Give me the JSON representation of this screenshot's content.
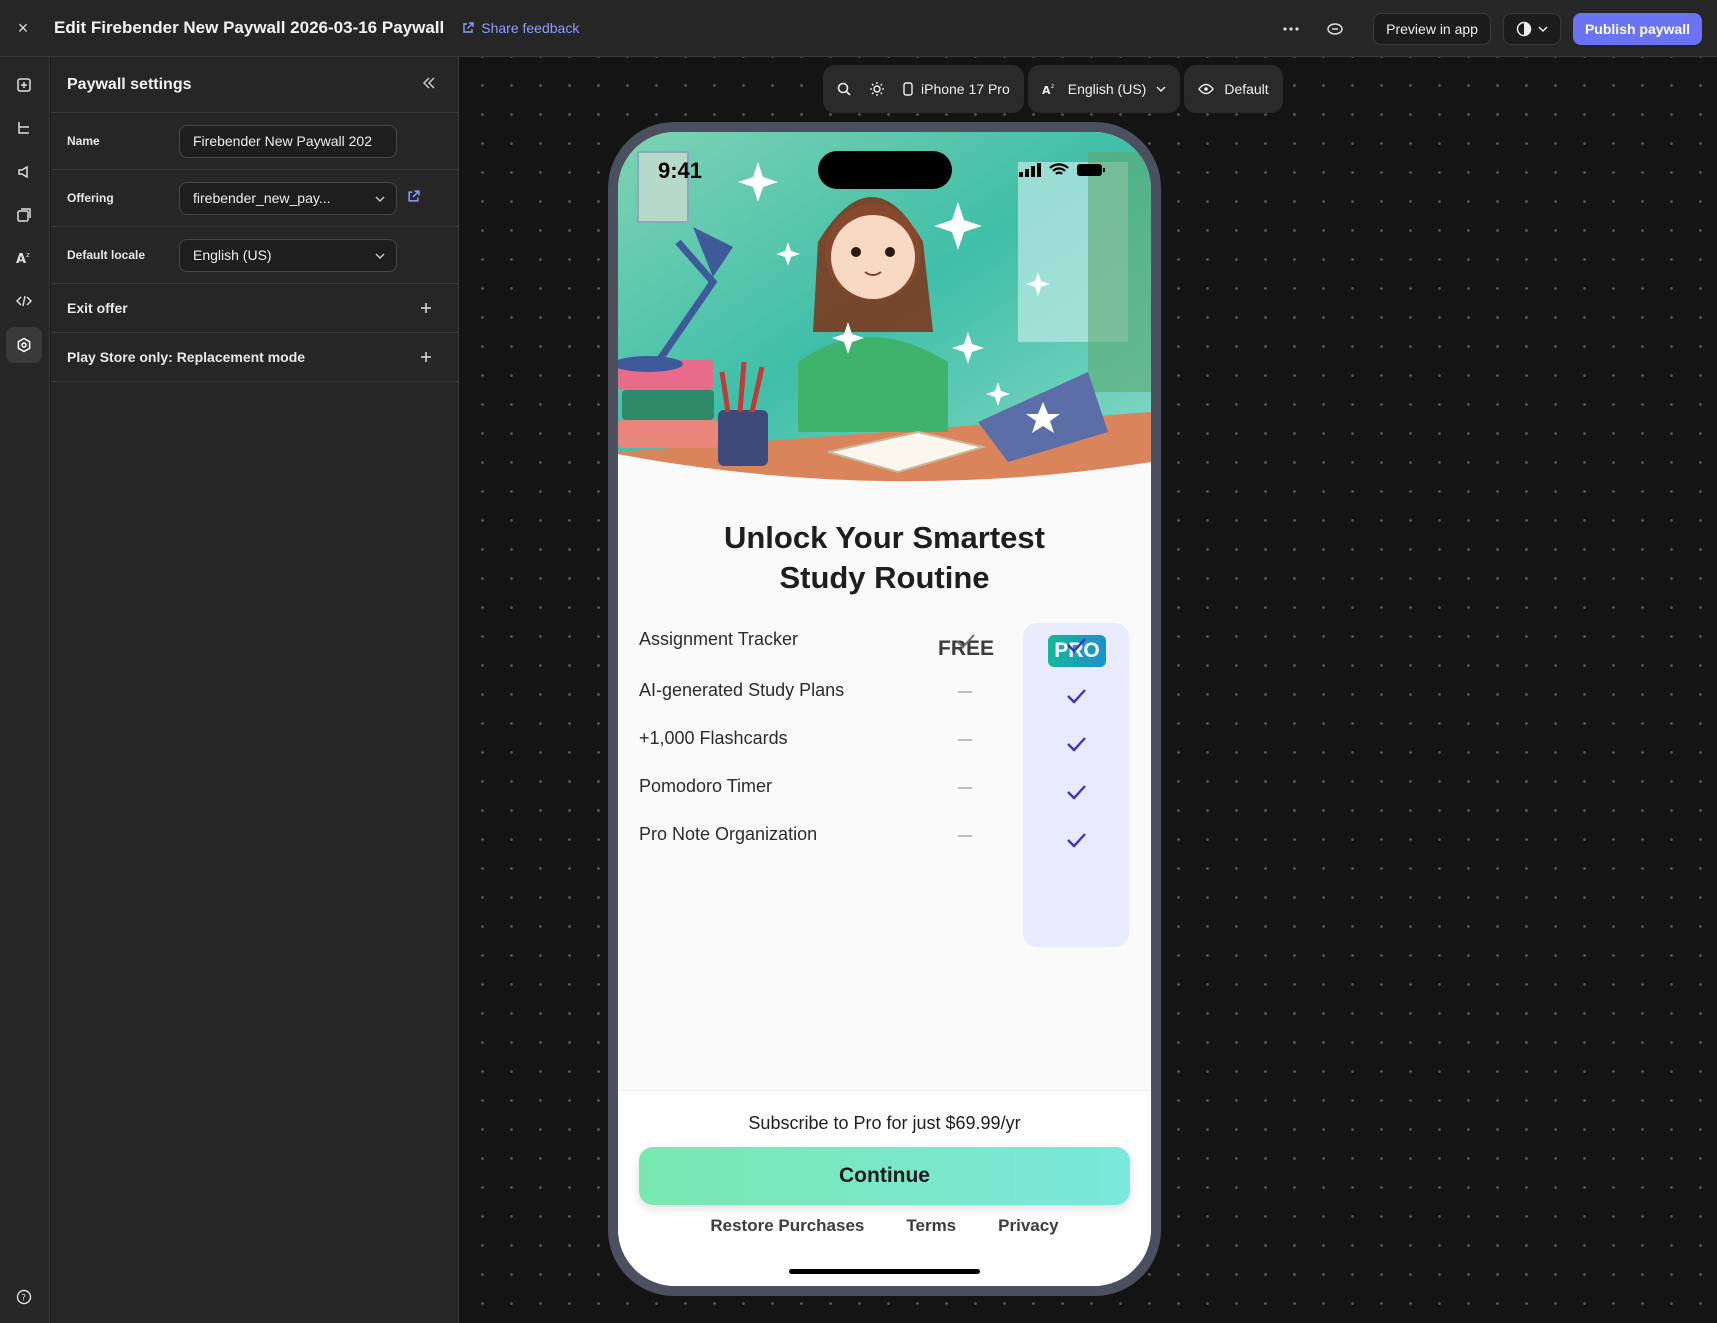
{
  "topbar": {
    "close_glyph": "×",
    "title": "Edit Firebender New Paywall 2026-03-16 Paywall",
    "feedback_label": "Share feedback",
    "more_icon": "more-icon",
    "preview_label": "Preview in app",
    "publish_label": "Publish paywall",
    "accent": "#6b73f5"
  },
  "rail": {
    "icons": [
      "add-component-icon",
      "layers-icon",
      "campaign-icon",
      "templates-icon",
      "localization-icon",
      "code-icon",
      "settings-icon",
      "help-icon"
    ]
  },
  "panel": {
    "title": "Paywall settings",
    "name_label": "Name",
    "name_value": "Firebender New Paywall 202",
    "offering_label": "Offering",
    "offering_value": "firebender_new_pay...",
    "locale_label": "Default locale",
    "locale_value": "English (US)",
    "exit_offer": "Exit offer",
    "replacement_mode": "Play Store only: Replacement mode"
  },
  "canvas_toolbar": {
    "device": "iPhone 17 Pro",
    "language": "English (US)",
    "variant": "Default"
  },
  "phone": {
    "time": "9:41",
    "headline_line1": "Unlock Your Smartest",
    "headline_line2": "Study Routine",
    "free_label": "FREE",
    "pro_label": "PRO",
    "features": [
      {
        "name": "Assignment Tracker",
        "free": "check",
        "pro": "check"
      },
      {
        "name": "AI-generated Study Plans",
        "free": "dash",
        "pro": "check"
      },
      {
        "name": "+1,000 Flashcards",
        "free": "dash",
        "pro": "check"
      },
      {
        "name": "Pomodoro Timer",
        "free": "dash",
        "pro": "check"
      },
      {
        "name": "Pro Note Organization",
        "free": "dash",
        "pro": "check"
      }
    ],
    "subscribe_text": "Subscribe to Pro for just $69.99/yr",
    "cta_label": "Continue",
    "links": [
      "Restore Purchases",
      "Terms",
      "Privacy"
    ],
    "pro_check_color": "#3b30c9"
  }
}
